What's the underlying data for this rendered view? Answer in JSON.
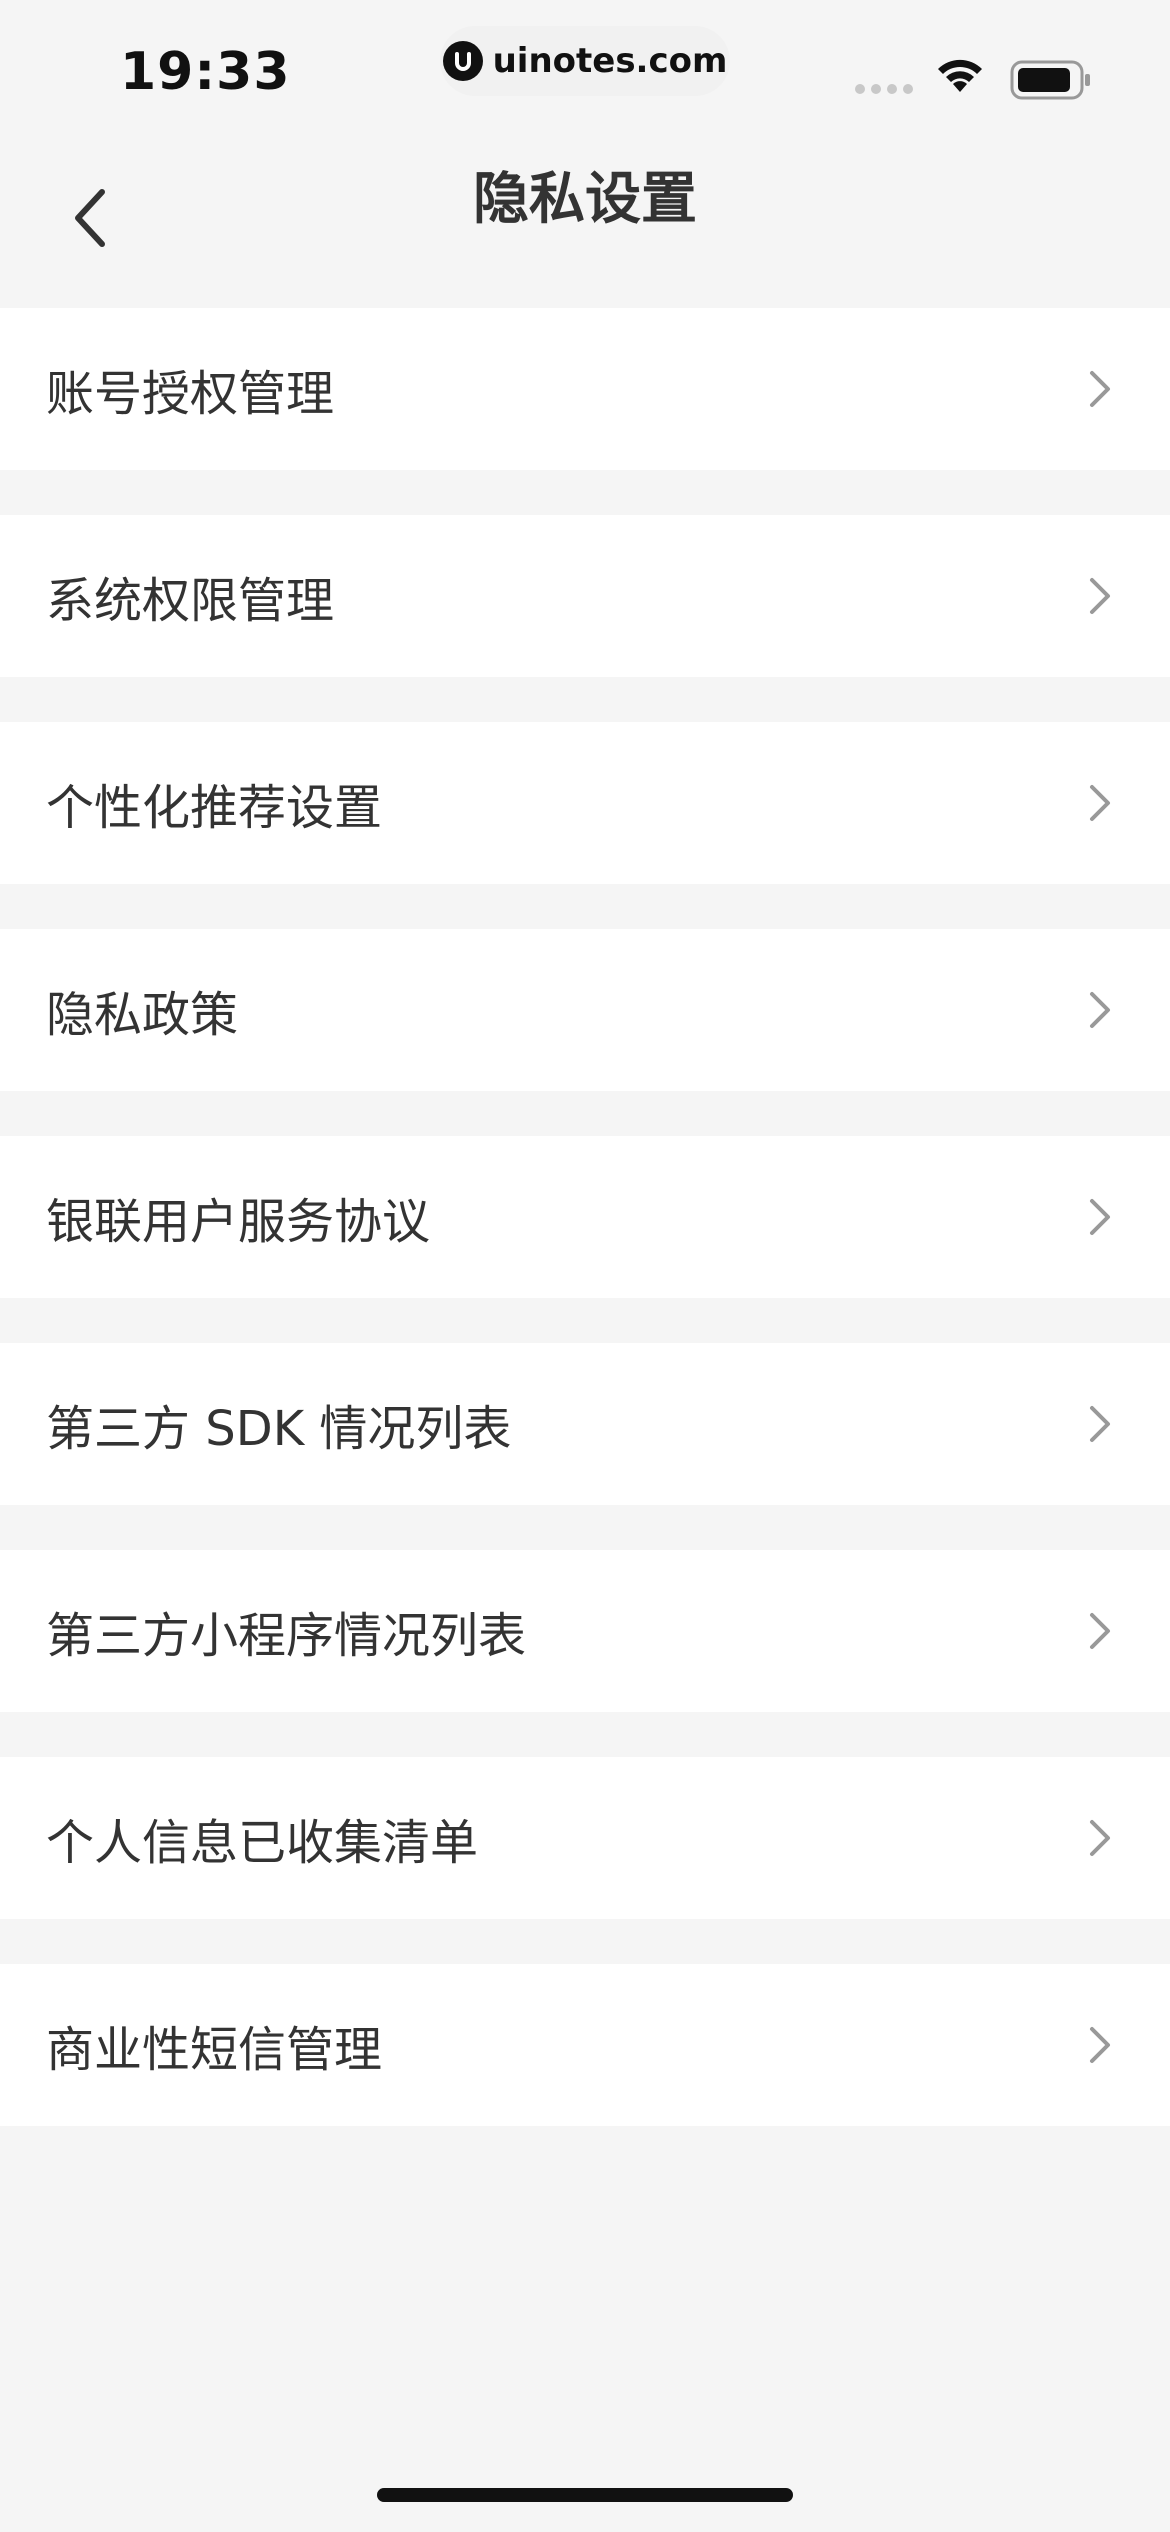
{
  "status_bar": {
    "time": "19:33",
    "url": "uinotes.com",
    "logo_icon": "uinotes-logo-icon",
    "wifi_icon": "wifi-icon",
    "battery_icon": "battery-icon"
  },
  "nav": {
    "title": "隐私设置",
    "back_icon": "chevron-left-icon"
  },
  "list": {
    "items": [
      {
        "label": "账号授权管理"
      },
      {
        "label": "系统权限管理"
      },
      {
        "label": "个性化推荐设置"
      },
      {
        "label": "隐私政策"
      },
      {
        "label": "银联用户服务协议"
      },
      {
        "label": "第三方 SDK 情况列表"
      },
      {
        "label": "第三方小程序情况列表"
      },
      {
        "label": "个人信息已收集清单"
      },
      {
        "label": "商业性短信管理"
      }
    ],
    "chevron_icon": "chevron-right-icon"
  },
  "colors": {
    "background": "#f5f5f5",
    "card": "#ffffff",
    "text": "#333333",
    "chevron": "#999999"
  }
}
